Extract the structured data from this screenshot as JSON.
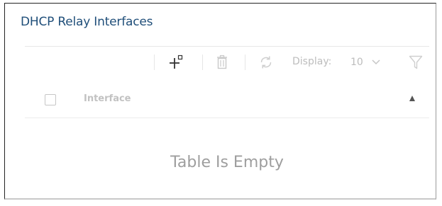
{
  "panel": {
    "title": "DHCP Relay Interfaces"
  },
  "toolbar": {
    "icons": [
      "add-icon",
      "delete-icon",
      "refresh-icon",
      "filter-icon"
    ],
    "display_label": "Display:",
    "display_value": "10"
  },
  "table": {
    "columns": [
      "Interface"
    ],
    "sort_indicator": "▲",
    "empty_text": "Table Is Empty"
  },
  "colors": {
    "title": "#1f4e79",
    "muted": "#bdbdbd",
    "empty_text": "#9e9e9e"
  }
}
